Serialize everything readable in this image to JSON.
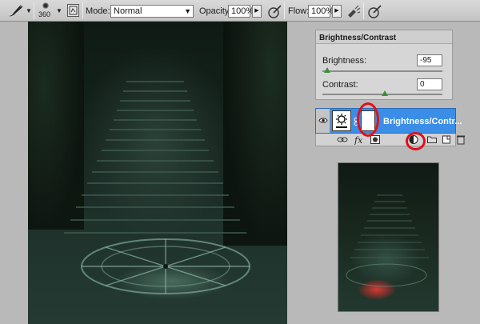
{
  "toolbar": {
    "brush_size": "360",
    "mode_label": "Mode:",
    "mode_value": "Normal",
    "opacity_label": "Opacity:",
    "opacity_value": "100%",
    "flow_label": "Flow:",
    "flow_value": "100%"
  },
  "adjustments": {
    "title": "Brightness/Contrast",
    "brightness_label": "Brightness:",
    "brightness_value": "-95",
    "contrast_label": "Contrast:",
    "contrast_value": "0"
  },
  "layer": {
    "name": "Brightness/Contr..."
  },
  "colors": {
    "selected_layer": "#3b8ee8",
    "highlight_ring": "#e0101a",
    "slider_thumb": "#3b8f3b"
  }
}
